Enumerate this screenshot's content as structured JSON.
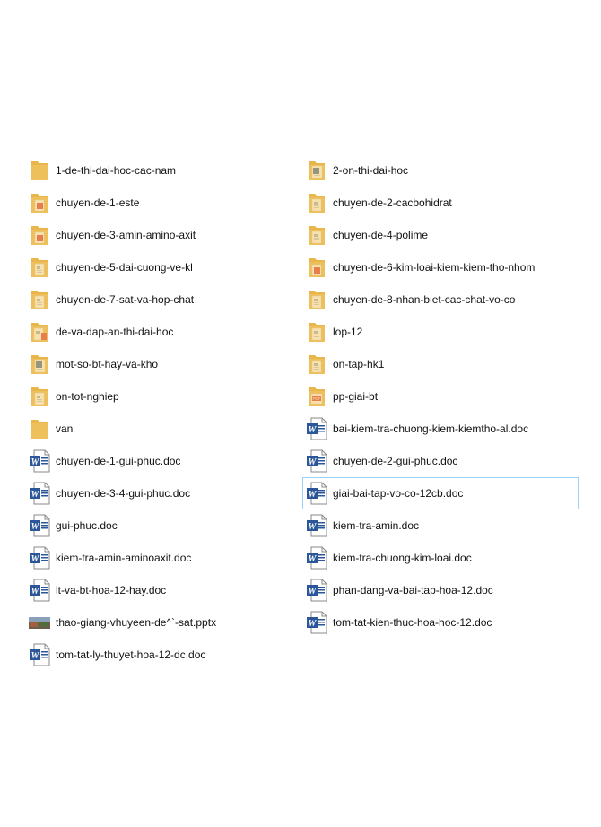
{
  "files": {
    "left": [
      {
        "name": "1-de-thi-dai-hoc-cac-nam",
        "icon": "folder-icon",
        "overlay": "none"
      },
      {
        "name": "chuyen-de-1-este",
        "icon": "folder-icon",
        "overlay": "pdf"
      },
      {
        "name": "chuyen-de-3-amin-amino-axit",
        "icon": "folder-icon",
        "overlay": "pdf"
      },
      {
        "name": "chuyen-de-5-dai-cuong-ve-kl",
        "icon": "folder-icon",
        "overlay": "doc"
      },
      {
        "name": "chuyen-de-7-sat-va-hop-chat",
        "icon": "folder-icon",
        "overlay": "doc"
      },
      {
        "name": "de-va-dap-an-thi-dai-hoc",
        "icon": "folder-icon",
        "overlay": "mixed"
      },
      {
        "name": "mot-so-bt-hay-va-kho",
        "icon": "folder-icon",
        "overlay": "word"
      },
      {
        "name": "on-tot-nghiep",
        "icon": "folder-icon",
        "overlay": "doc"
      },
      {
        "name": "van",
        "icon": "folder-icon",
        "overlay": "none"
      },
      {
        "name": "chuyen-de-1-gui-phuc.doc",
        "icon": "word-doc-icon"
      },
      {
        "name": "chuyen-de-3-4-gui-phuc.doc",
        "icon": "word-doc-icon"
      },
      {
        "name": "gui-phuc.doc",
        "icon": "word-doc-icon"
      },
      {
        "name": "kiem-tra-amin-aminoaxit.doc",
        "icon": "word-doc-icon"
      },
      {
        "name": "lt-va-bt-hoa-12-hay.doc",
        "icon": "word-doc-icon"
      },
      {
        "name": "thao-giang-vhuyeen-de^`-sat.pptx",
        "icon": "pptx-thumbnail-icon"
      },
      {
        "name": "tom-tat-ly-thuyet-hoa-12-dc.doc",
        "icon": "word-doc-icon"
      }
    ],
    "right": [
      {
        "name": "2-on-thi-dai-hoc",
        "icon": "folder-icon",
        "overlay": "word"
      },
      {
        "name": "chuyen-de-2-cacbohidrat",
        "icon": "folder-icon",
        "overlay": "doc"
      },
      {
        "name": "chuyen-de-4-polime",
        "icon": "folder-icon",
        "overlay": "doc"
      },
      {
        "name": "chuyen-de-6-kim-loai-kiem-kiem-tho-nhom",
        "icon": "folder-icon",
        "overlay": "pdf"
      },
      {
        "name": "chuyen-de-8-nhan-biet-cac-chat-vo-co",
        "icon": "folder-icon",
        "overlay": "doc"
      },
      {
        "name": "lop-12",
        "icon": "folder-icon",
        "overlay": "doc"
      },
      {
        "name": "on-tap-hk1",
        "icon": "folder-icon",
        "overlay": "doc"
      },
      {
        "name": "pp-giai-bt",
        "icon": "folder-icon",
        "overlay": "pdf-label"
      },
      {
        "name": "bai-kiem-tra-chuong-kiem-kiemtho-al.doc",
        "icon": "word-doc-icon"
      },
      {
        "name": "chuyen-de-2-gui-phuc.doc",
        "icon": "word-doc-icon"
      },
      {
        "name": "giai-bai-tap-vo-co-12cb.doc",
        "icon": "word-doc-icon",
        "selected": true
      },
      {
        "name": "kiem-tra-amin.doc",
        "icon": "word-doc-icon"
      },
      {
        "name": "kiem-tra-chuong-kim-loai.doc",
        "icon": "word-doc-icon"
      },
      {
        "name": "phan-dang-va-bai-tap-hoa-12.doc",
        "icon": "word-doc-icon"
      },
      {
        "name": "tom-tat-kien-thuc-hoa-hoc-12.doc",
        "icon": "word-doc-icon"
      }
    ]
  },
  "colors": {
    "folder": "#f3c969",
    "folder_back": "#e8b64a",
    "word_blue": "#2b579a",
    "pdf_red": "#d7262b",
    "selection_border": "#99d1ff"
  }
}
